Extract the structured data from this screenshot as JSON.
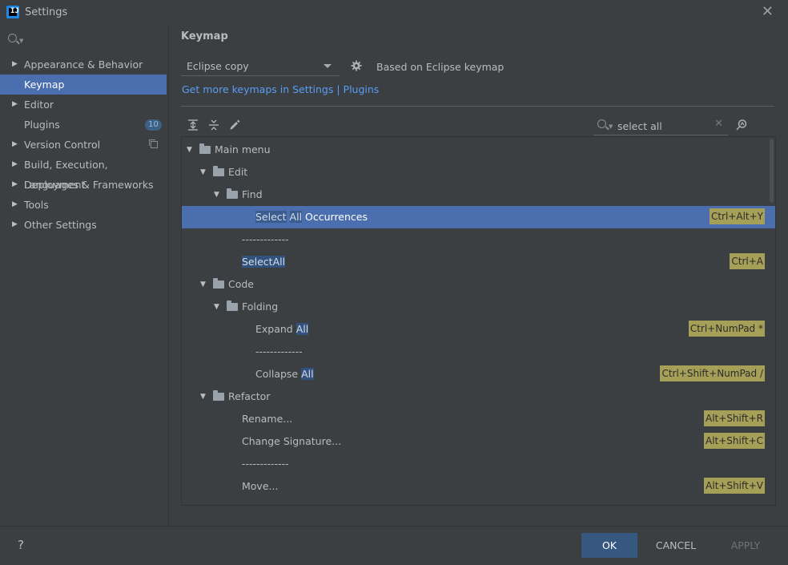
{
  "window": {
    "title": "Settings"
  },
  "sidebar": {
    "items": [
      {
        "label": "Appearance & Behavior",
        "expandable": true
      },
      {
        "label": "Keymap",
        "selected": true
      },
      {
        "label": "Editor",
        "expandable": true
      },
      {
        "label": "Plugins",
        "badge": "10"
      },
      {
        "label": "Version Control",
        "expandable": true
      },
      {
        "label": "Build, Execution, Deployment",
        "expandable": true
      },
      {
        "label": "Languages & Frameworks",
        "expandable": true
      },
      {
        "label": "Tools",
        "expandable": true
      },
      {
        "label": "Other Settings",
        "expandable": true
      }
    ]
  },
  "keymap": {
    "heading": "Keymap",
    "selected": "Eclipse copy",
    "based_on": "Based on Eclipse keymap",
    "link": "Get more keymaps in Settings | Plugins",
    "filter_value": "select all"
  },
  "tree": {
    "main_menu": "Main menu",
    "edit": "Edit",
    "find": "Find",
    "select_all_occ": {
      "hl1": "Select",
      "hl2": "All",
      "rest": " Occurrences",
      "shortcut": "Ctrl+Alt+Y"
    },
    "sep1": "-------------",
    "select_all": {
      "hl1": "Select",
      "hl2": "All",
      "shortcut": "Ctrl+A"
    },
    "code": "Code",
    "folding": "Folding",
    "expand_all": {
      "pre": "Expand ",
      "hl": "All",
      "shortcut": "Ctrl+NumPad *"
    },
    "sep2": "-------------",
    "collapse_all": {
      "pre": "Collapse ",
      "hl": "All",
      "shortcut": "Ctrl+Shift+NumPad /"
    },
    "refactor": "Refactor",
    "rename": {
      "label": "Rename...",
      "shortcut": "Alt+Shift+R"
    },
    "change_sig": {
      "label": "Change Signature...",
      "shortcut": "Alt+Shift+C"
    },
    "sep3": "-------------",
    "move": {
      "label": "Move...",
      "shortcut": "Alt+Shift+V"
    }
  },
  "footer": {
    "help": "?",
    "ok": "OK",
    "cancel": "CANCEL",
    "apply": "APPLY"
  },
  "colors": {
    "accent": "#4b6eaf",
    "link": "#589df6",
    "shortcut_bg": "#a69f57",
    "background": "#3c3f41"
  }
}
